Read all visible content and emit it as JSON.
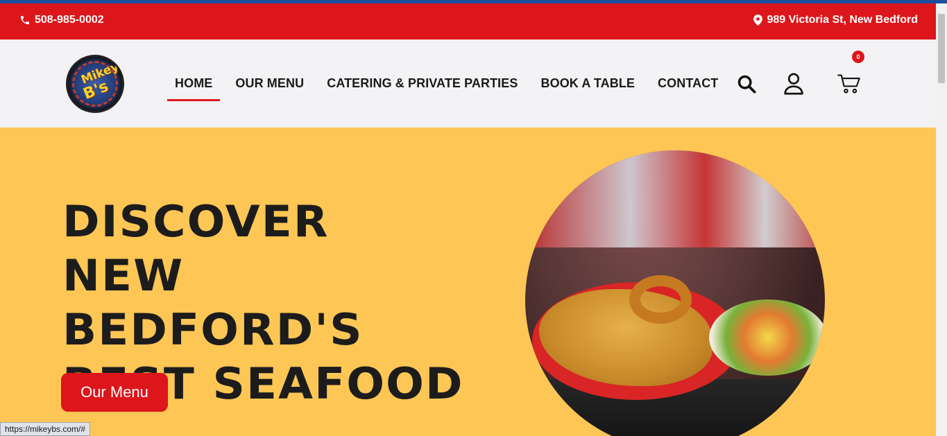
{
  "topbar": {
    "phone": "508-985-0002",
    "address": "989 Victoria St, New Bedford"
  },
  "header": {
    "logo": {
      "line1": "Mikey",
      "line2": "B's"
    },
    "nav": [
      {
        "label": "HOME",
        "active": true
      },
      {
        "label": "OUR MENU",
        "active": false
      },
      {
        "label": "CATERING & PRIVATE PARTIES",
        "active": false
      },
      {
        "label": "BOOK A TABLE",
        "active": false
      },
      {
        "label": "CONTACT",
        "active": false
      }
    ],
    "cart_count": "0",
    "icons": [
      "search-icon",
      "user-icon",
      "cart-icon"
    ]
  },
  "hero": {
    "headline": "DISCOVER NEW BEDFORD'S BEST SEAFOOD",
    "button_label": "Our Menu"
  },
  "status_bar": {
    "url": "https://mikeybs.com/#"
  },
  "colors": {
    "brand_red": "#dd161b",
    "hero_yellow": "#fec654",
    "top_stripe_blue": "#1c4f9c"
  }
}
